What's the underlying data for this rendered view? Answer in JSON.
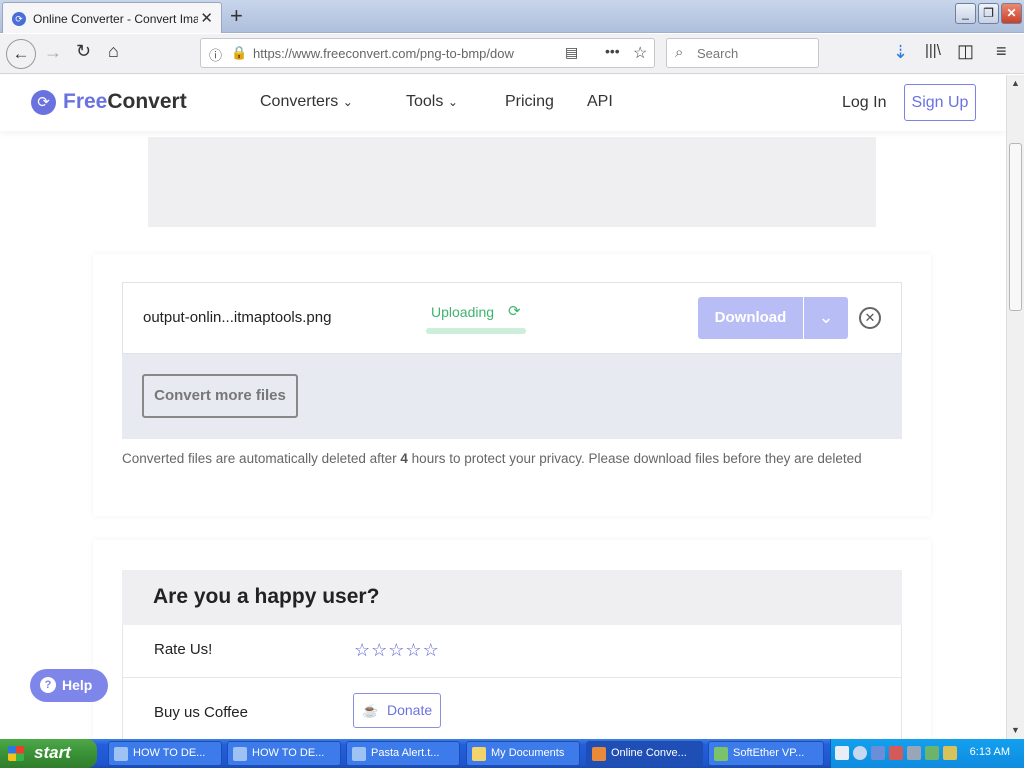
{
  "browser": {
    "tab_title": "Online Converter - Convert Image",
    "new_tab": "+",
    "url": "https://www.freeconvert.com/png-to-bmp/dow",
    "search_placeholder": "Search"
  },
  "header": {
    "logo_free": "Free",
    "logo_convert": "Convert",
    "nav": [
      "Converters",
      "Tools",
      "Pricing",
      "API"
    ],
    "login": "Log In",
    "signup": "Sign Up"
  },
  "file": {
    "name": "output-onlin...itmaptools.png",
    "status": "Uploading",
    "progress": 1.0,
    "download_label": "Download"
  },
  "convert_more_label": "Convert more files",
  "privacy": {
    "before": "Converted files are automatically deleted after ",
    "hours": "4",
    "after": " hours to protect your privacy. Please download files before they are deleted"
  },
  "happy": {
    "title": "Are you a happy user?",
    "rate_label": "Rate Us!",
    "stars": 5,
    "coffee_label": "Buy us Coffee",
    "donate_label": "Donate"
  },
  "help_label": "Help",
  "taskbar": {
    "start_label": "start",
    "tasks": [
      "HOW TO DE...",
      "HOW TO DE...",
      "Pasta Alert.t...",
      "My Documents",
      "Online Conve...",
      "SoftEther VP..."
    ],
    "clock": "6:13 AM"
  },
  "colors": {
    "accent": "#6a72e0",
    "download_disabled": "#b9bdf6",
    "status_green": "#3eb46e"
  }
}
